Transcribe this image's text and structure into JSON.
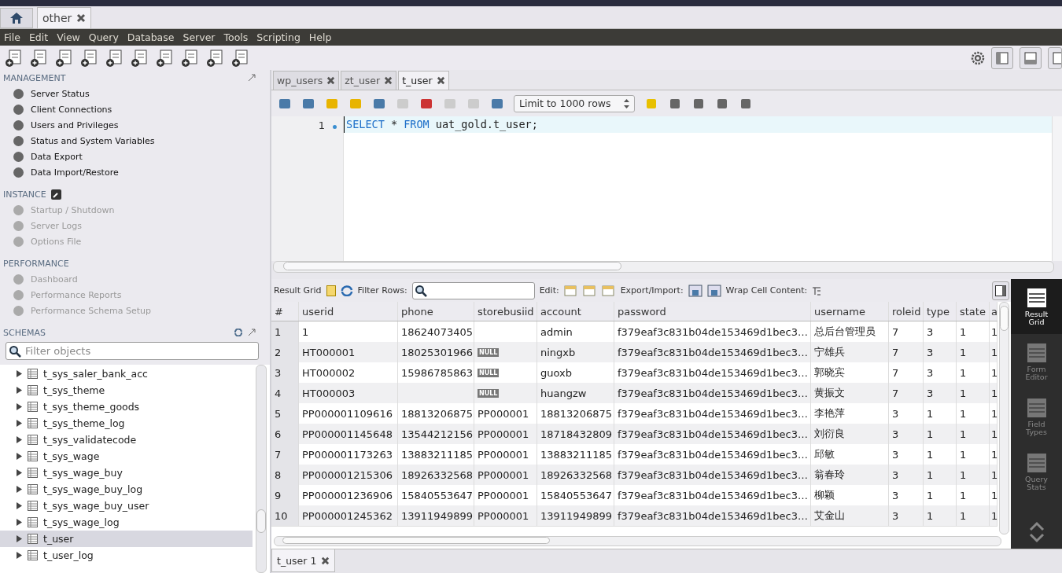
{
  "app_tabs": [
    {
      "label": "other",
      "selected": true
    }
  ],
  "menu": [
    "File",
    "Edit",
    "View",
    "Query",
    "Database",
    "Server",
    "Tools",
    "Scripting",
    "Help"
  ],
  "sidebar": {
    "sections": [
      {
        "title": "MANAGEMENT",
        "items": [
          {
            "label": "Server Status",
            "disabled": false
          },
          {
            "label": "Client Connections",
            "disabled": false
          },
          {
            "label": "Users and Privileges",
            "disabled": false
          },
          {
            "label": "Status and System Variables",
            "disabled": false
          },
          {
            "label": "Data Export",
            "disabled": false
          },
          {
            "label": "Data Import/Restore",
            "disabled": false
          }
        ]
      },
      {
        "title": "INSTANCE",
        "items": [
          {
            "label": "Startup / Shutdown",
            "disabled": true
          },
          {
            "label": "Server Logs",
            "disabled": true
          },
          {
            "label": "Options File",
            "disabled": true
          }
        ]
      },
      {
        "title": "PERFORMANCE",
        "items": [
          {
            "label": "Dashboard",
            "disabled": true
          },
          {
            "label": "Performance Reports",
            "disabled": true
          },
          {
            "label": "Performance Schema Setup",
            "disabled": true
          }
        ]
      }
    ],
    "schemas": {
      "title": "SCHEMAS",
      "placeholder": "Filter objects",
      "items": [
        {
          "label": "t_sys_saler_bank_acc",
          "expanded": false,
          "selected": false
        },
        {
          "label": "t_sys_theme",
          "expanded": false,
          "selected": false
        },
        {
          "label": "t_sys_theme_goods",
          "expanded": false,
          "selected": false
        },
        {
          "label": "t_sys_theme_log",
          "expanded": false,
          "selected": false
        },
        {
          "label": "t_sys_validatecode",
          "expanded": false,
          "selected": false
        },
        {
          "label": "t_sys_wage",
          "expanded": false,
          "selected": false
        },
        {
          "label": "t_sys_wage_buy",
          "expanded": false,
          "selected": false
        },
        {
          "label": "t_sys_wage_buy_log",
          "expanded": false,
          "selected": false
        },
        {
          "label": "t_sys_wage_buy_user",
          "expanded": false,
          "selected": false
        },
        {
          "label": "t_sys_wage_log",
          "expanded": false,
          "selected": false
        },
        {
          "label": "t_user",
          "expanded": false,
          "selected": true
        },
        {
          "label": "t_user_log",
          "expanded": false,
          "selected": false
        }
      ]
    }
  },
  "query_tabs": [
    {
      "label": "wp_users",
      "selected": false
    },
    {
      "label": "zt_user",
      "selected": false
    },
    {
      "label": "t_user",
      "selected": true
    }
  ],
  "limit_select": {
    "value": "Limit to 1000 rows"
  },
  "editor": {
    "line_number": "1",
    "code": [
      {
        "text": "SELECT",
        "kind": "keyword"
      },
      {
        "text": " * ",
        "kind": "plain"
      },
      {
        "text": "FROM",
        "kind": "keyword"
      },
      {
        "text": " uat_gold.t_user;",
        "kind": "plain"
      }
    ]
  },
  "result_toolbar": {
    "result_grid": "Result Grid",
    "filter_label": "Filter Rows:",
    "edit_label": "Edit:",
    "export_label": "Export/Import:",
    "wrap_label": "Wrap Cell Content:"
  },
  "table": {
    "columns": [
      "#",
      "userid",
      "phone",
      "storebusiid",
      "account",
      "password",
      "username",
      "roleid",
      "type",
      "state",
      "a"
    ],
    "rows": [
      [
        "1",
        "1",
        "18624073405",
        null,
        "admin",
        "f379eaf3c831b04de153469d1bec3…",
        "总后台管理员",
        "7",
        "3",
        "1",
        "1"
      ],
      [
        "2",
        "HT000001",
        "18025301966",
        {
          "kind": "null",
          "text": "NULL"
        },
        "ningxb",
        "f379eaf3c831b04de153469d1bec3…",
        "宁雄兵",
        "7",
        "3",
        "1",
        "1"
      ],
      [
        "3",
        "HT000002",
        "15986785863",
        {
          "kind": "null",
          "text": "NULL"
        },
        "guoxb",
        "f379eaf3c831b04de153469d1bec3…",
        "郭晓宾",
        "7",
        "3",
        "1",
        "1"
      ],
      [
        "4",
        "HT000003",
        null,
        {
          "kind": "null",
          "text": "NULL"
        },
        "huangzw",
        "f379eaf3c831b04de153469d1bec3…",
        "黄振文",
        "7",
        "3",
        "1",
        "1"
      ],
      [
        "5",
        "PP000001109616",
        "18813206875",
        "PP000001",
        "18813206875",
        "f379eaf3c831b04de153469d1bec3…",
        "李艳萍",
        "3",
        "1",
        "1",
        "1"
      ],
      [
        "6",
        "PP000001145648",
        "13544212156",
        "PP000001",
        "18718432809",
        "f379eaf3c831b04de153469d1bec3…",
        "刘衍良",
        "3",
        "1",
        "1",
        "1"
      ],
      [
        "7",
        "PP000001173263",
        "13883211185",
        "PP000001",
        "13883211185",
        "f379eaf3c831b04de153469d1bec3…",
        "邱敏",
        "3",
        "1",
        "1",
        "1"
      ],
      [
        "8",
        "PP000001215306",
        "18926332568",
        "PP000001",
        "18926332568",
        "f379eaf3c831b04de153469d1bec3…",
        "翁春玲",
        "3",
        "1",
        "1",
        "1"
      ],
      [
        "9",
        "PP000001236906",
        "15840553647",
        "PP000001",
        "15840553647",
        "f379eaf3c831b04de153469d1bec3…",
        "柳颖",
        "3",
        "1",
        "1",
        "1"
      ],
      [
        "10",
        "PP000001245362",
        "13911949899",
        "PP000001",
        "13911949899",
        "f379eaf3c831b04de153469d1bec3…",
        "艾金山",
        "3",
        "1",
        "1",
        "1"
      ]
    ]
  },
  "side_panel": [
    {
      "label": "Result Grid",
      "selected": true
    },
    {
      "label": "Form Editor",
      "selected": false
    },
    {
      "label": "Field Types",
      "selected": false
    },
    {
      "label": "Query Stats",
      "selected": false
    }
  ],
  "result_tabs": [
    {
      "label": "t_user 1",
      "selected": true
    }
  ]
}
